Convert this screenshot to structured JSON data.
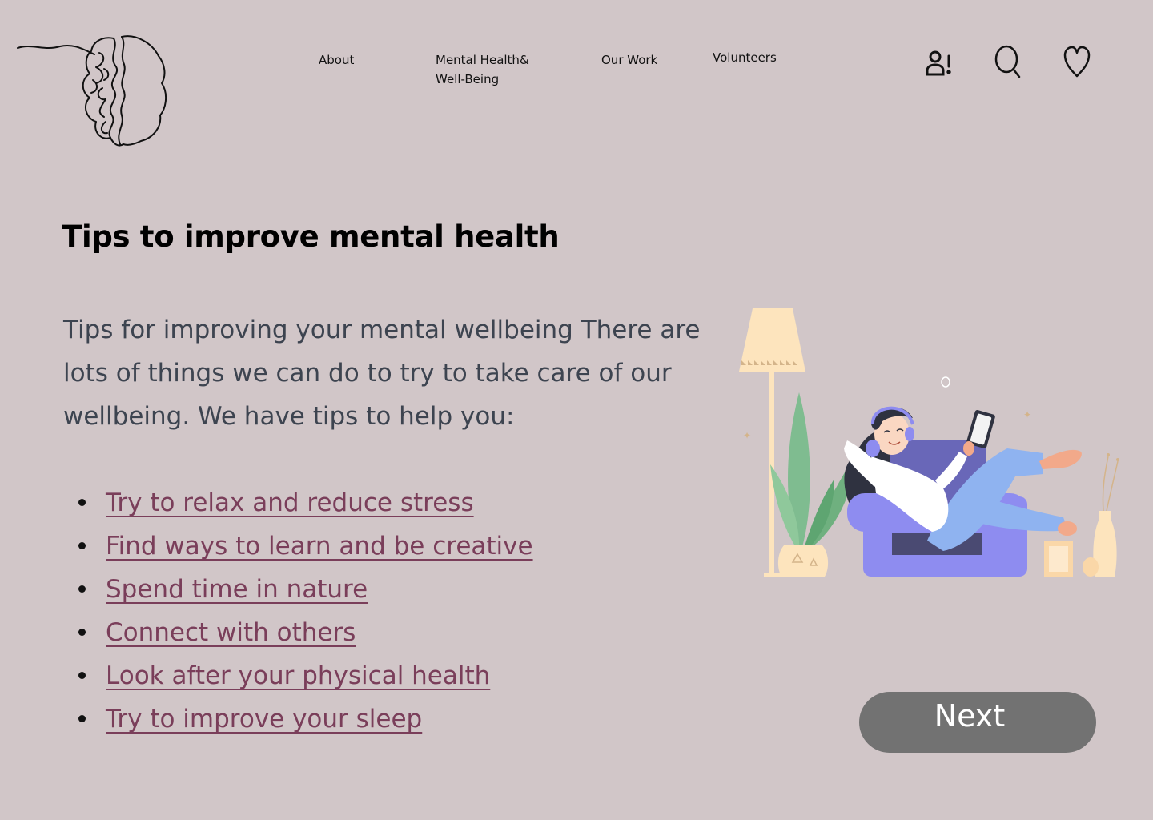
{
  "header": {
    "logo_icon": "brain-line-art-icon",
    "nav": [
      {
        "label": "About"
      },
      {
        "label": "Mental Health& Well-Being"
      },
      {
        "label": "Our Work"
      },
      {
        "label": "Volunteers"
      }
    ],
    "icons": [
      "user-alert-icon",
      "search-icon",
      "heart-icon"
    ]
  },
  "main": {
    "title": "Tips to improve mental health",
    "intro": "Tips for improving your mental wellbeing There are lots of things we can do to try to take care of our wellbeing. We have tips to help you:",
    "tips": [
      {
        "label": "Try to relax and reduce stress"
      },
      {
        "label": "Find ways to learn and be creative"
      },
      {
        "label": "Spend time in nature"
      },
      {
        "label": "Connect with others"
      },
      {
        "label": "Look after your physical health"
      },
      {
        "label": "Try to improve your sleep"
      }
    ],
    "illustration_icon": "woman-relaxing-armchair-illustration",
    "next_label": "Next"
  },
  "colors": {
    "background": "#d1c6c8",
    "link": "#7a3e5a",
    "body_text": "#3d4450",
    "button": "#727272"
  }
}
